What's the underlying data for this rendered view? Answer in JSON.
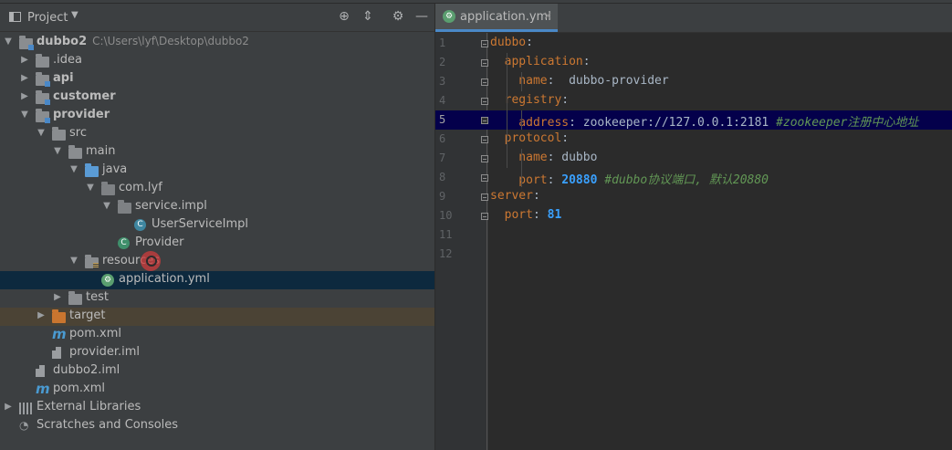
{
  "project_panel": {
    "title": "Project",
    "header_icons": [
      "locate-icon",
      "collapse-icon",
      "settings-icon",
      "minimize-icon"
    ],
    "tree": [
      {
        "label": "dubbo2",
        "path": "C:\\Users\\lyf\\Desktop\\dubbo2",
        "icon": "module-folder-icon",
        "expanded": true,
        "bold": true
      },
      {
        "label": ".idea",
        "icon": "folder-icon",
        "expanded": false
      },
      {
        "label": "api",
        "icon": "module-folder-icon",
        "expanded": false,
        "bold": true
      },
      {
        "label": "customer",
        "icon": "module-folder-icon",
        "expanded": false,
        "bold": true
      },
      {
        "label": "provider",
        "icon": "module-folder-icon",
        "expanded": true,
        "bold": true
      },
      {
        "label": "src",
        "icon": "folder-icon",
        "expanded": true
      },
      {
        "label": "main",
        "icon": "folder-icon",
        "expanded": true
      },
      {
        "label": "java",
        "icon": "source-folder-icon",
        "expanded": true
      },
      {
        "label": "com.lyf",
        "icon": "package-icon",
        "expanded": true
      },
      {
        "label": "service.impl",
        "icon": "package-icon",
        "expanded": true
      },
      {
        "label": "UserServiceImpl",
        "icon": "class-icon"
      },
      {
        "label": "Provider",
        "icon": "spring-boot-class-icon"
      },
      {
        "label": "resources",
        "icon": "resources-folder-icon",
        "expanded": true
      },
      {
        "label": "application.yml",
        "icon": "spring-yml-icon",
        "selected": true
      },
      {
        "label": "test",
        "icon": "folder-icon",
        "expanded": false
      },
      {
        "label": "target",
        "icon": "excluded-folder-icon",
        "expanded": false,
        "highlighted": true
      },
      {
        "label": "pom.xml",
        "icon": "maven-icon"
      },
      {
        "label": "provider.iml",
        "icon": "iml-file-icon"
      },
      {
        "label": "dubbo2.iml",
        "icon": "iml-file-icon"
      },
      {
        "label": "pom.xml",
        "icon": "maven-icon"
      },
      {
        "label": "External Libraries",
        "icon": "libraries-icon",
        "expanded": false
      },
      {
        "label": "Scratches and Consoles",
        "icon": "scratches-icon"
      }
    ]
  },
  "editor": {
    "tab": {
      "label": "application.yml",
      "icon": "spring-yml-icon",
      "close": "×"
    },
    "current_line": 5,
    "lines": [
      {
        "n": "1",
        "tokens": [
          {
            "t": "dubbo",
            "c": "key"
          },
          {
            "t": ":",
            "c": "val"
          }
        ]
      },
      {
        "n": "2",
        "tokens": [
          {
            "t": "  application",
            "c": "key"
          },
          {
            "t": ":",
            "c": "val"
          }
        ]
      },
      {
        "n": "3",
        "tokens": [
          {
            "t": "    name",
            "c": "key"
          },
          {
            "t": ":  dubbo-provider",
            "c": "val"
          }
        ]
      },
      {
        "n": "4",
        "tokens": [
          {
            "t": "  registry",
            "c": "key"
          },
          {
            "t": ":",
            "c": "val"
          }
        ]
      },
      {
        "n": "5",
        "tokens": [
          {
            "t": "    address",
            "c": "key"
          },
          {
            "t": ": zookeeper://127.0.0.1:2181 ",
            "c": "val"
          },
          {
            "t": "#zookeeper注册中心地址",
            "c": "cmt"
          }
        ]
      },
      {
        "n": "6",
        "tokens": [
          {
            "t": "  protocol",
            "c": "key"
          },
          {
            "t": ":",
            "c": "val"
          }
        ]
      },
      {
        "n": "7",
        "tokens": [
          {
            "t": "    name",
            "c": "key"
          },
          {
            "t": ": dubbo",
            "c": "val"
          }
        ]
      },
      {
        "n": "8",
        "tokens": [
          {
            "t": "    port",
            "c": "key"
          },
          {
            "t": ": ",
            "c": "val"
          },
          {
            "t": "20880",
            "c": "num2"
          },
          {
            "t": " #dubbo协议端口, 默认20880",
            "c": "cmt"
          }
        ]
      },
      {
        "n": "9",
        "tokens": [
          {
            "t": "server",
            "c": "key"
          },
          {
            "t": ":",
            "c": "val"
          }
        ]
      },
      {
        "n": "10",
        "tokens": [
          {
            "t": "  port",
            "c": "key"
          },
          {
            "t": ": ",
            "c": "val"
          },
          {
            "t": "81",
            "c": "num2"
          }
        ]
      },
      {
        "n": "11",
        "tokens": []
      },
      {
        "n": "12",
        "tokens": []
      }
    ]
  },
  "colors": {
    "panel_bg": "#3c3f41",
    "editor_bg": "#2b2b2b",
    "selection": "#0d293e",
    "current_line": "#04004b",
    "yaml_key": "#cc7832",
    "number": "#3aa1ff",
    "comment": "#629755"
  }
}
